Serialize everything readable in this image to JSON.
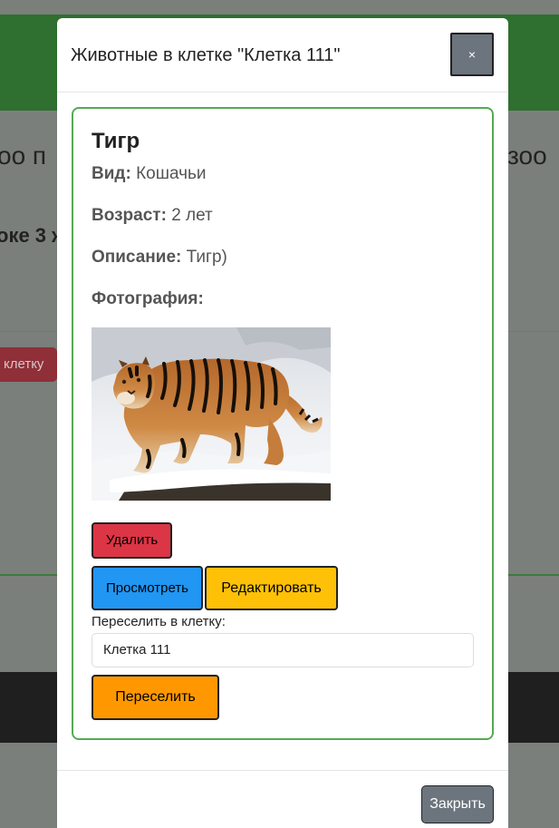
{
  "background": {
    "title_left": "оо п",
    "title_right": "зоо",
    "subtitle": "оке 3 ж",
    "red_button": "клетку"
  },
  "modal": {
    "title": "Животные в клетке \"Клетка 111\"",
    "close_x": "×",
    "close_button": "Закрыть"
  },
  "animal": {
    "name": "Тигр",
    "species_label": "Вид:",
    "species": "Кошачьи",
    "age_label": "Возраст:",
    "age": "2 лет",
    "description_label": "Описание:",
    "description": "Тигр)",
    "photo_label": "Фотография:"
  },
  "actions": {
    "delete": "Удалить",
    "view": "Просмотреть",
    "edit": "Редактировать",
    "move_label": "Переселить в клетку:",
    "selected_cage": "Клетка 111",
    "move": "Переселить"
  },
  "colors": {
    "delete": "#dc3545",
    "view": "#2196f3",
    "edit": "#ffc107",
    "move": "#ff9800",
    "card_border": "#55aa55"
  }
}
